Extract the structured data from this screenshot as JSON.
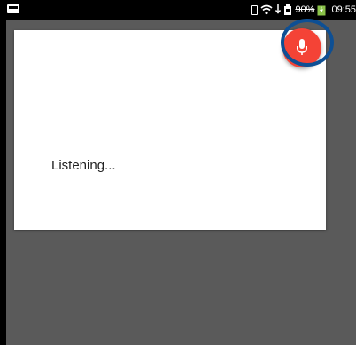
{
  "status_bar": {
    "icons": [
      "picture-icon",
      "vibrate-icon",
      "wifi-icon",
      "download-icon",
      "battery-icon"
    ],
    "battery_percent": "90%",
    "time": "09:55"
  },
  "dialog": {
    "message": "Listening..."
  },
  "mic": {
    "icon": "microphone-icon",
    "color": "#f44336"
  },
  "highlight": {
    "color": "#0d4f94"
  }
}
